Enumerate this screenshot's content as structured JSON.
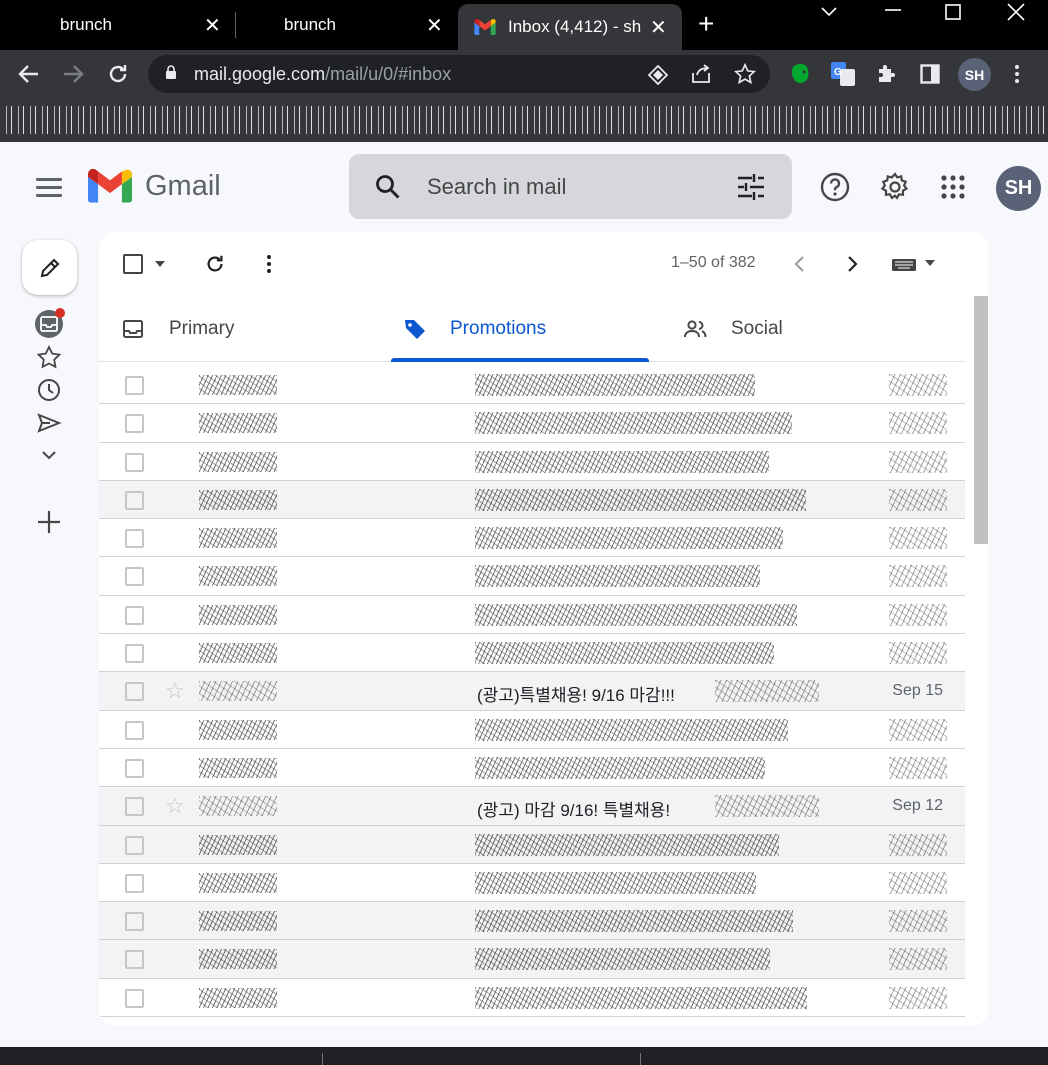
{
  "browser": {
    "tabs": [
      {
        "title": "brunch",
        "active": false
      },
      {
        "title": "brunch",
        "active": false
      },
      {
        "title": "Inbox (4,412) - sh",
        "active": true
      }
    ],
    "close_glyph": "✕",
    "new_tab_glyph": "+",
    "url_host": "mail.google.com",
    "url_path": "/mail/u/0/#inbox",
    "profile_initials": "SH"
  },
  "gmail": {
    "product_name": "Gmail",
    "search_placeholder": "Search in mail",
    "avatar_initials": "SH",
    "pager_text": "1–50 of 382",
    "categories": [
      {
        "label": "Primary",
        "icon": "inbox-icon",
        "active": false
      },
      {
        "label": "Promotions",
        "icon": "tag-icon",
        "active": true
      },
      {
        "label": "Social",
        "icon": "people-icon",
        "active": false
      }
    ],
    "rows": [
      {
        "subject": "",
        "date": "",
        "read": false,
        "redacted": true
      },
      {
        "subject": "",
        "date": "",
        "read": false,
        "redacted": true
      },
      {
        "subject": "",
        "date": "",
        "read": false,
        "redacted": true
      },
      {
        "subject": "",
        "date": "",
        "read": true,
        "redacted": true
      },
      {
        "subject": "",
        "date": "",
        "read": false,
        "redacted": true
      },
      {
        "subject": "",
        "date": "",
        "read": false,
        "redacted": true
      },
      {
        "subject": "",
        "date": "",
        "read": false,
        "redacted": true
      },
      {
        "subject": "",
        "date": "",
        "read": false,
        "redacted": true
      },
      {
        "subject": "(광고)특별채용! 9/16 마감!!!",
        "date": "Sep 15",
        "read": true,
        "redacted": false
      },
      {
        "subject": "",
        "date": "",
        "read": false,
        "redacted": true
      },
      {
        "subject": "",
        "date": "",
        "read": false,
        "redacted": true
      },
      {
        "subject": "(광고) 마감 9/16! 특별채용!",
        "date": "Sep 12",
        "read": true,
        "redacted": false
      },
      {
        "subject": "",
        "date": "",
        "read": true,
        "redacted": true
      },
      {
        "subject": "",
        "date": "",
        "read": false,
        "redacted": true
      },
      {
        "subject": "",
        "date": "",
        "read": true,
        "redacted": true
      },
      {
        "subject": "",
        "date": "",
        "read": true,
        "redacted": true
      },
      {
        "subject": "",
        "date": "",
        "read": false,
        "redacted": true
      }
    ]
  },
  "colors": {
    "accent": "#0b57d0",
    "chrome_bg": "#35363a",
    "tabstrip_bg": "#000000",
    "gmail_bg": "#f6f8fc"
  }
}
